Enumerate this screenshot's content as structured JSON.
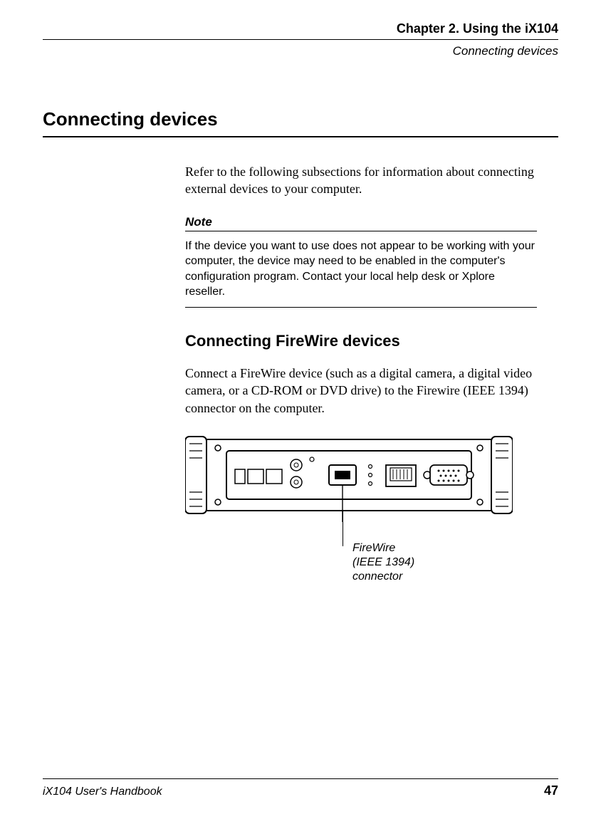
{
  "header": {
    "chapter": "Chapter 2. Using the iX104",
    "section": "Connecting devices"
  },
  "h1": "Connecting devices",
  "intro": "Refer to the following subsections for information about connecting external devices to your computer.",
  "note": {
    "label": "Note",
    "body": "If the device you want to use does not appear to be working with your computer, the device may need to be enabled in the computer's configuration program. Contact your local help desk or Xplore reseller."
  },
  "h2": "Connecting FireWire devices",
  "sub": "Connect a FireWire device (such as a digital camera, a digital video camera, or a CD-ROM or DVD drive) to the Firewire (IEEE 1394) connector on the computer.",
  "figure": {
    "callout": "FireWire\n(IEEE 1394)\nconnector"
  },
  "footer": {
    "book": "iX104 User's Handbook",
    "page": "47"
  }
}
